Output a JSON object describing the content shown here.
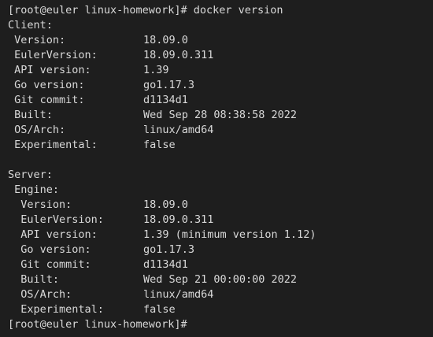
{
  "terminal": {
    "partial_top_line": "[root@euler linux-homework]#",
    "command_line": "[root@euler linux-homework]# docker version",
    "client_header": "Client:",
    "client": [
      {
        "key": " Version:",
        "value": "18.09.0"
      },
      {
        "key": " EulerVersion:",
        "value": "18.09.0.311"
      },
      {
        "key": " API version:",
        "value": "1.39"
      },
      {
        "key": " Go version:",
        "value": "go1.17.3"
      },
      {
        "key": " Git commit:",
        "value": "d1134d1"
      },
      {
        "key": " Built:",
        "value": "Wed Sep 28 08:38:58 2022"
      },
      {
        "key": " OS/Arch:",
        "value": "linux/amd64"
      },
      {
        "key": " Experimental:",
        "value": "false"
      }
    ],
    "server_header": "Server:",
    "engine_header": " Engine:",
    "server": [
      {
        "key": "  Version:",
        "value": "18.09.0"
      },
      {
        "key": "  EulerVersion:",
        "value": "18.09.0.311"
      },
      {
        "key": "  API version:",
        "value": "1.39 (minimum version 1.12)"
      },
      {
        "key": "  Go version:",
        "value": "go1.17.3"
      },
      {
        "key": "  Git commit:",
        "value": "d1134d1"
      },
      {
        "key": "  Built:",
        "value": "Wed Sep 21 00:00:00 2022"
      },
      {
        "key": "  OS/Arch:",
        "value": "linux/amd64"
      },
      {
        "key": "  Experimental:",
        "value": "false"
      }
    ],
    "final_prompt": "[root@euler linux-homework]#",
    "colors": {
      "background": "#1e1e1e",
      "text": "#d9d9d9"
    }
  }
}
